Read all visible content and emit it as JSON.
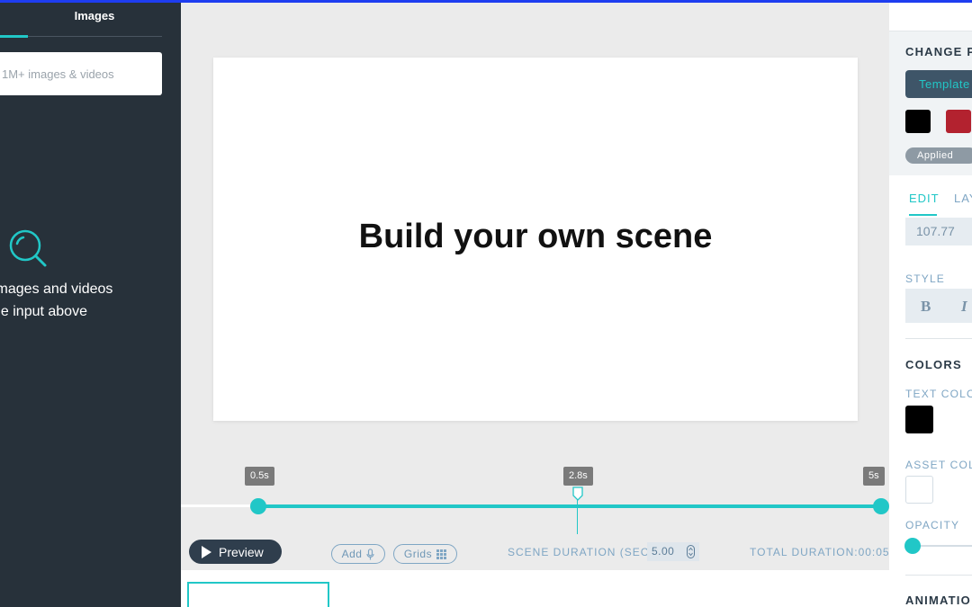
{
  "left_panel": {
    "tab_label": "Images",
    "search": {
      "placeholder": "1M+ images & videos",
      "value": ""
    },
    "empty_icon": "search-icon",
    "empty_message_line1": "images and videos",
    "empty_message_line2": "he input above"
  },
  "canvas": {
    "title": "Build your own scene"
  },
  "timeline": {
    "start_label": "0.5s",
    "marker_label": "2.8s",
    "end_label": "5s"
  },
  "bottom_bar": {
    "preview_label": "Preview",
    "add_label": "Add",
    "add_icon": "microphone-icon",
    "grids_label": "Grids",
    "grids_icon": "grid-icon",
    "scene_duration_label": "SCENE DURATION (SEC)",
    "scene_duration_value": "5.00",
    "total_duration_label": "TOTAL DURATION:00:05"
  },
  "right_panel": {
    "change_heading": "CHANGE P",
    "template_button": "Template",
    "swatches": [
      "#000000",
      "#b3222f"
    ],
    "applied_badge": "Applied",
    "tabs": {
      "edit": "EDIT",
      "layout": "LAY"
    },
    "size_value": "107.77",
    "style_label": "STYLE",
    "style_bold": "B",
    "style_italic": "I",
    "colors_heading": "COLORS",
    "text_color_label": "TEXT COLO",
    "text_color": "#000000",
    "asset_color_label": "ASSET COL",
    "asset_color": "#ffffff",
    "opacity_label": "OPACITY",
    "opacity_value": 0,
    "animation_heading": "ANIMATIO"
  },
  "colors": {
    "accent": "#21c7c7",
    "sidebar_bg": "#27313a",
    "preview_button": "#2f3e4d"
  }
}
